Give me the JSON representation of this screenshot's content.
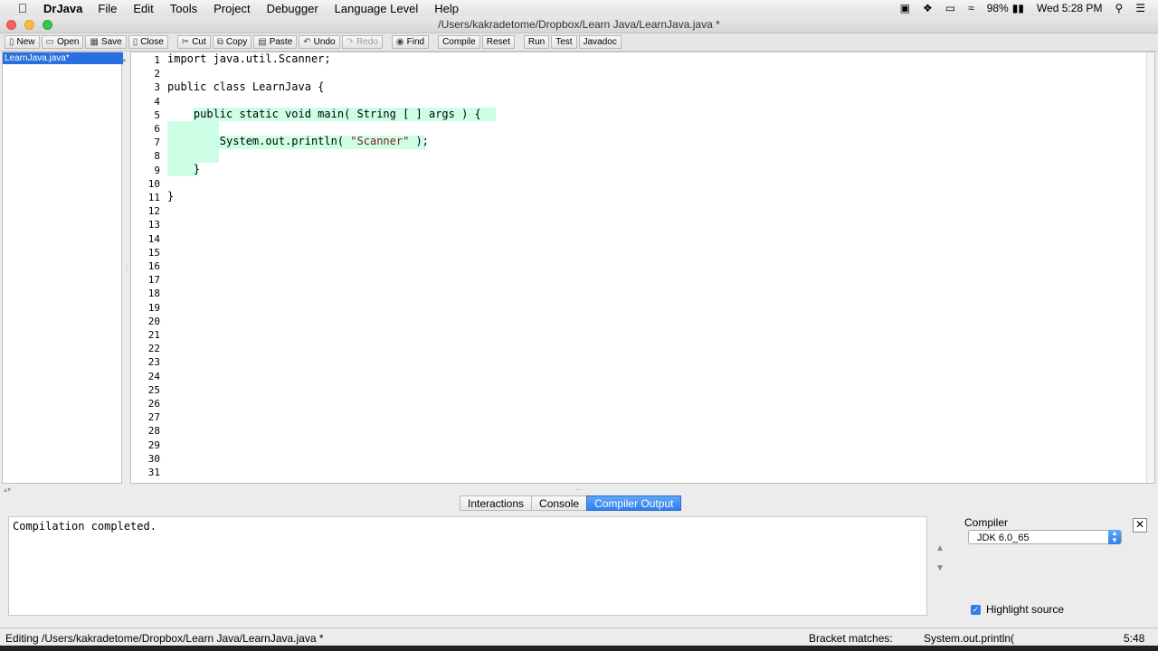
{
  "menubar": {
    "app_name": "DrJava",
    "menus": [
      "File",
      "Edit",
      "Tools",
      "Project",
      "Debugger",
      "Language Level",
      "Help"
    ],
    "battery": "98%",
    "clock": "Wed 5:28 PM"
  },
  "window": {
    "title": "/Users/kakradetome/Dropbox/Learn Java/LearnJava.java *"
  },
  "toolbar": {
    "new": "New",
    "open": "Open",
    "save": "Save",
    "close": "Close",
    "cut": "Cut",
    "copy": "Copy",
    "paste": "Paste",
    "undo": "Undo",
    "redo": "Redo",
    "find": "Find",
    "compile": "Compile",
    "reset": "Reset",
    "run": "Run",
    "test": "Test",
    "javadoc": "Javadoc"
  },
  "files": {
    "selected": "LearnJava.java*"
  },
  "editor": {
    "line_numbers": [
      "1",
      "2",
      "3",
      "4",
      "5",
      "6",
      "7",
      "8",
      "9",
      "10",
      "11",
      "12",
      "13",
      "14",
      "15",
      "16",
      "17",
      "18",
      "19",
      "20",
      "21",
      "22",
      "23",
      "24",
      "25",
      "26",
      "27",
      "28",
      "29",
      "30",
      "31"
    ],
    "lines": {
      "l1": "import java.util.Scanner;",
      "l3": "public class LearnJava {",
      "l5": "    public static void main( String [ ] args ) {",
      "l7_pre": "        System.out.println( ",
      "l7_str": "\"Scanner\"",
      "l7_post": " );",
      "l9": "    }",
      "l11": "}"
    }
  },
  "bottom_tabs": {
    "interactions": "Interactions",
    "console": "Console",
    "compiler_output": "Compiler Output"
  },
  "output": {
    "text": "Compilation completed."
  },
  "compiler": {
    "label": "Compiler",
    "selected": "JDK 6.0_65",
    "highlight_source": "Highlight source"
  },
  "status": {
    "editing": "Editing /Users/kakradetome/Dropbox/Learn Java/LearnJava.java *",
    "bracket_label": "Bracket matches:",
    "bracket_value": "System.out.println(",
    "position": "5:48"
  }
}
